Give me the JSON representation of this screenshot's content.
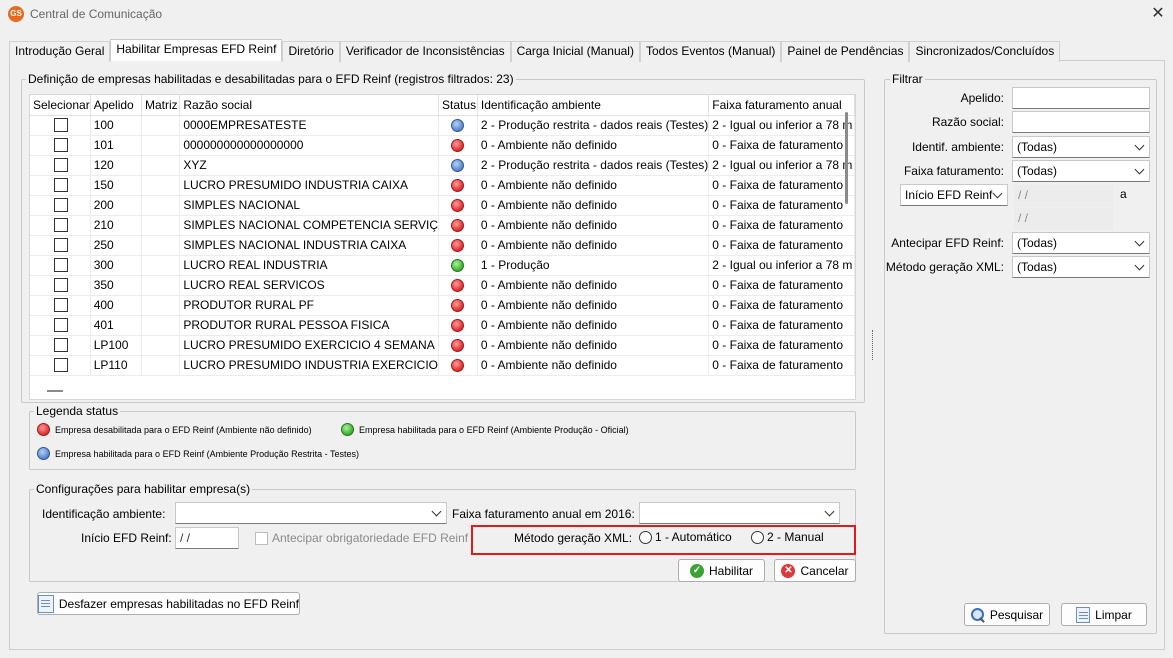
{
  "window": {
    "title": "Central de Comunicação",
    "app_icon": "GS",
    "close_label": "✕"
  },
  "tabs": [
    {
      "label": "Introdução Geral"
    },
    {
      "label": "Habilitar Empresas EFD Reinf",
      "active": true
    },
    {
      "label": "Diretório"
    },
    {
      "label": "Verificador de Inconsistências"
    },
    {
      "label": "Carga Inicial (Manual)"
    },
    {
      "label": "Todos Eventos (Manual)"
    },
    {
      "label": "Painel de Pendências"
    },
    {
      "label": "Sincronizados/Concluídos"
    }
  ],
  "companies_group": {
    "title": "Definição de empresas habilitadas e desabilitadas para o EFD Reinf (registros filtrados: 23)",
    "columns": [
      "Selecionar",
      "Apelido",
      "Matriz",
      "Razão social",
      "Status",
      "Identificação ambiente",
      "Faixa faturamento anual"
    ],
    "rows": [
      {
        "apelido": "100",
        "razao": "0000EMPRESATESTE",
        "status": "blue",
        "ambiente": "2 - Produção restrita - dados reais (Testes)",
        "faixa": "2 - Igual ou inferior a 78 m"
      },
      {
        "apelido": "101",
        "razao": "000000000000000000",
        "status": "red",
        "ambiente": "0 - Ambiente não definido",
        "faixa": "0 - Faixa de faturamento"
      },
      {
        "apelido": "120",
        "razao": "XYZ",
        "status": "blue",
        "ambiente": "2 - Produção restrita - dados reais (Testes)",
        "faixa": "2 - Igual ou inferior a 78 m"
      },
      {
        "apelido": "150",
        "razao": "LUCRO PRESUMIDO INDUSTRIA CAIXA",
        "status": "red",
        "ambiente": "0 - Ambiente não definido",
        "faixa": "0 - Faixa de faturamento"
      },
      {
        "apelido": "200",
        "razao": "SIMPLES NACIONAL",
        "status": "red",
        "ambiente": "0 - Ambiente não definido",
        "faixa": "0 - Faixa de faturamento"
      },
      {
        "apelido": "210",
        "razao": "SIMPLES NACIONAL COMPETENCIA SERVIÇ",
        "status": "red",
        "ambiente": "0 - Ambiente não definido",
        "faixa": "0 - Faixa de faturamento"
      },
      {
        "apelido": "250",
        "razao": "SIMPLES NACIONAL INDUSTRIA CAIXA",
        "status": "red",
        "ambiente": "0 - Ambiente não definido",
        "faixa": "0 - Faixa de faturamento"
      },
      {
        "apelido": "300",
        "razao": "LUCRO REAL INDUSTRIA",
        "status": "green",
        "ambiente": "1 - Produção",
        "faixa": "2 - Igual ou inferior a 78 m"
      },
      {
        "apelido": "350",
        "razao": "LUCRO REAL SERVICOS",
        "status": "red",
        "ambiente": "0 - Ambiente não definido",
        "faixa": "0 - Faixa de faturamento"
      },
      {
        "apelido": "400",
        "razao": "PRODUTOR RURAL PF",
        "status": "red",
        "ambiente": "0 - Ambiente não definido",
        "faixa": "0 - Faixa de faturamento"
      },
      {
        "apelido": "401",
        "razao": "PRODUTOR RURAL PESSOA FISICA",
        "status": "red",
        "ambiente": "0 - Ambiente não definido",
        "faixa": "0 - Faixa de faturamento"
      },
      {
        "apelido": "LP100",
        "razao": "LUCRO PRESUMIDO EXERCICIO 4 SEMANA",
        "status": "red",
        "ambiente": "0 - Ambiente não definido",
        "faixa": "0 - Faixa de faturamento"
      },
      {
        "apelido": "LP110",
        "razao": "LUCRO PRESUMIDO INDUSTRIA EXERCICIO",
        "status": "red",
        "ambiente": "0 - Ambiente não definido",
        "faixa": "0 - Faixa de faturamento"
      }
    ]
  },
  "legend": {
    "title": "Legenda status",
    "items": [
      {
        "color": "red",
        "text": "Empresa desabilitada para o EFD Reinf (Ambiente não definido)"
      },
      {
        "color": "green",
        "text": "Empresa habilitada para o EFD Reinf (Ambiente Produção - Oficial)"
      },
      {
        "color": "blue",
        "text": "Empresa habilitada para o EFD Reinf (Ambiente Produção Restrita - Testes)"
      }
    ]
  },
  "config": {
    "title": "Configurações para habilitar empresa(s)",
    "ambiente_label": "Identificação ambiente:",
    "ambiente_value": "",
    "faixa_label": "Faixa faturamento anual em 2016:",
    "faixa_value": "",
    "inicio_label": "Início EFD Reinf:",
    "inicio_value": " /  /",
    "antecipar_label": "Antecipar obrigatoriedade EFD Reinf",
    "metodo_label": "Método geração XML:",
    "metodo_opt1": "1 - Automático",
    "metodo_opt2": "2 - Manual",
    "habilitar_label": "Habilitar",
    "cancelar_label": "Cancelar",
    "desfazer_label": "Desfazer empresas habilitadas no EFD Reinf"
  },
  "filter": {
    "title": "Filtrar",
    "apelido_label": "Apelido:",
    "apelido_value": "",
    "razao_label": "Razão social:",
    "razao_value": "",
    "ambiente_label": "Identif. ambiente:",
    "ambiente_value": "(Todas)",
    "faixa_label": "Faixa faturamento:",
    "faixa_value": "(Todas)",
    "inicio_select": "Início EFD Reinf",
    "date_from": " /  /",
    "date_sep": "a",
    "date_to": " /  /",
    "antecipar_label": "Antecipar EFD Reinf:",
    "antecipar_value": "(Todas)",
    "metodo_label": "Método geração XML:",
    "metodo_value": "(Todas)",
    "pesquisar_label": "Pesquisar",
    "limpar_label": "Limpar"
  },
  "colors": {
    "highlight_box": "#e01b1b",
    "status_red": "#e23a3a",
    "status_blue": "#5f8fd6",
    "status_green": "#44b83b"
  }
}
